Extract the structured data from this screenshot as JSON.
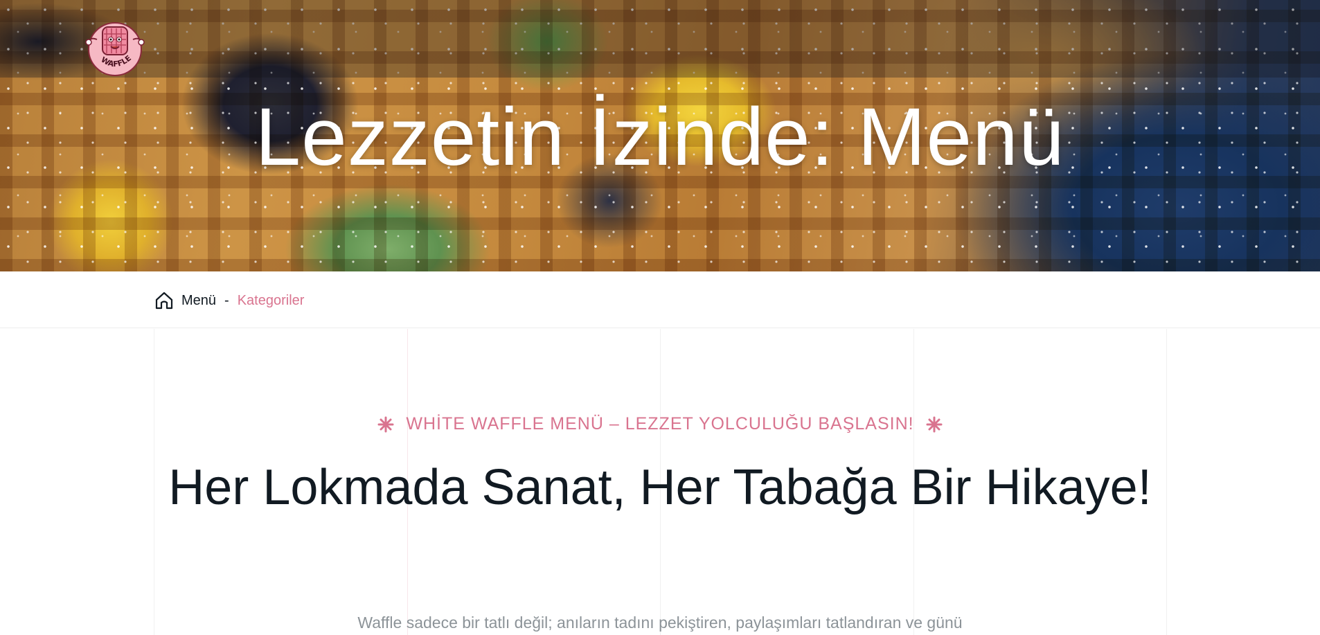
{
  "brand": {
    "logo_text": "WAFFLE",
    "accent_color": "#d9748f"
  },
  "hero": {
    "title": "Lezzetin İzinde: Menü"
  },
  "breadcrumb": {
    "home_label": "Menü",
    "separator": "-",
    "current": "Kategoriler"
  },
  "section": {
    "eyebrow": "WHİTE WAFFLE MENÜ – LEZZET YOLCULUĞU BAŞLASIN!",
    "headline": "Her Lokmada Sanat, Her Tabağa Bir Hikaye!",
    "body": "Waffle sadece bir tatlı değil; anıların tadını pekiştiren, paylaşımları tatlandıran ve günü"
  },
  "icons": [
    "waffle-mascot-logo",
    "home-icon",
    "asterisk-star-icon"
  ]
}
